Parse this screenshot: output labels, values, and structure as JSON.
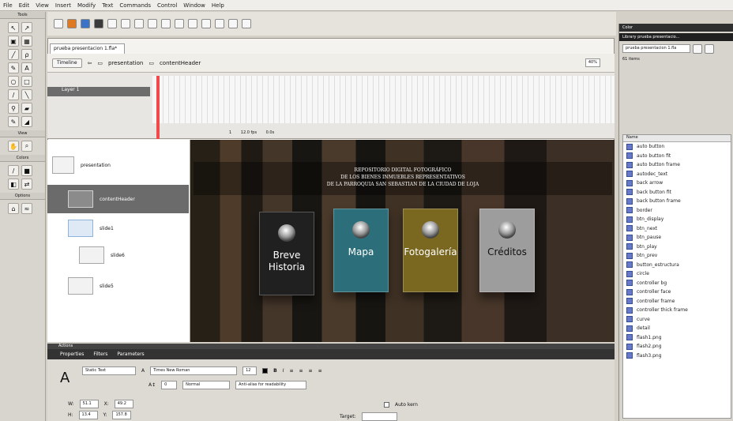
{
  "menu": [
    "File",
    "Edit",
    "View",
    "Insert",
    "Modify",
    "Text",
    "Commands",
    "Control",
    "Window",
    "Help"
  ],
  "tools": {
    "title": "Tools",
    "view": "View",
    "colors": "Colors",
    "options": "Options"
  },
  "document": {
    "tab": "prueba presentacion 1.fla*",
    "scene_label": "Timeline",
    "breadcrumb_1": "presentation",
    "breadcrumb_2": "contentHeader",
    "zoom": "40%"
  },
  "timeline": {
    "layer": "Layer 1",
    "frame_info": "1",
    "fps": "12.0 fps",
    "time": "0.0s"
  },
  "left_tree": [
    {
      "label": "presentation",
      "selected": false
    },
    {
      "label": "contentHeader",
      "selected": true
    },
    {
      "label": "slide1",
      "selected": false
    },
    {
      "label": "slide6",
      "selected": false
    },
    {
      "label": "slide5",
      "selected": false
    }
  ],
  "stage": {
    "banner_line_1": "REPOSITORIO DIGITAL FOTOGRÁFICO",
    "banner_line_2": "DE LOS BIENES INMUEBLES REPRESENTATIVOS",
    "banner_line_3": "DE LA PARROQUIA SAN SEBASTIAN DE LA CIUDAD DE LOJA",
    "cards": [
      {
        "label": "Breve Historia",
        "color": "#202020"
      },
      {
        "label": "Mapa",
        "color": "#2c6f7a"
      },
      {
        "label": "Fotogalería",
        "color": "#7a6720"
      },
      {
        "label": "Créditos",
        "color": "#9d9d9d"
      }
    ]
  },
  "right_panel": {
    "top_tab": "Color",
    "library_tab": "Library  prueba presentacio...",
    "dropdown": "prueba presentacion 1.fla",
    "items_label": "61 items",
    "name_header": "Name",
    "items": [
      "auto button",
      "auto button fit",
      "auto button frame",
      "autodec_text",
      "back arrow",
      "back button fit",
      "back button frame",
      "border",
      "btn_display",
      "btn_next",
      "btn_pause",
      "btn_play",
      "btn_prev",
      "button_estructura",
      "circle",
      "controller bg",
      "controller face",
      "controller frame",
      "controller thick frame",
      "curve",
      "detail",
      "flash1.png",
      "flash2.png",
      "flash3.png"
    ]
  },
  "bottom": {
    "tabs": [
      "Properties",
      "Filters",
      "Parameters"
    ],
    "panel_label": "Actions",
    "text_type": "Static Text",
    "font": "Times New Roman",
    "size": "12",
    "letter_spacing": "0",
    "format": "Normal",
    "anti_alias": "Anti-alias for readability",
    "w_label": "W:",
    "w_value": "51.1",
    "x_label": "X:",
    "x_value": "49.2",
    "h_label": "H:",
    "h_value": "13.4",
    "y_label": "Y:",
    "y_value": "157.8",
    "auto_kern": "Auto kern",
    "target": "Target:"
  }
}
